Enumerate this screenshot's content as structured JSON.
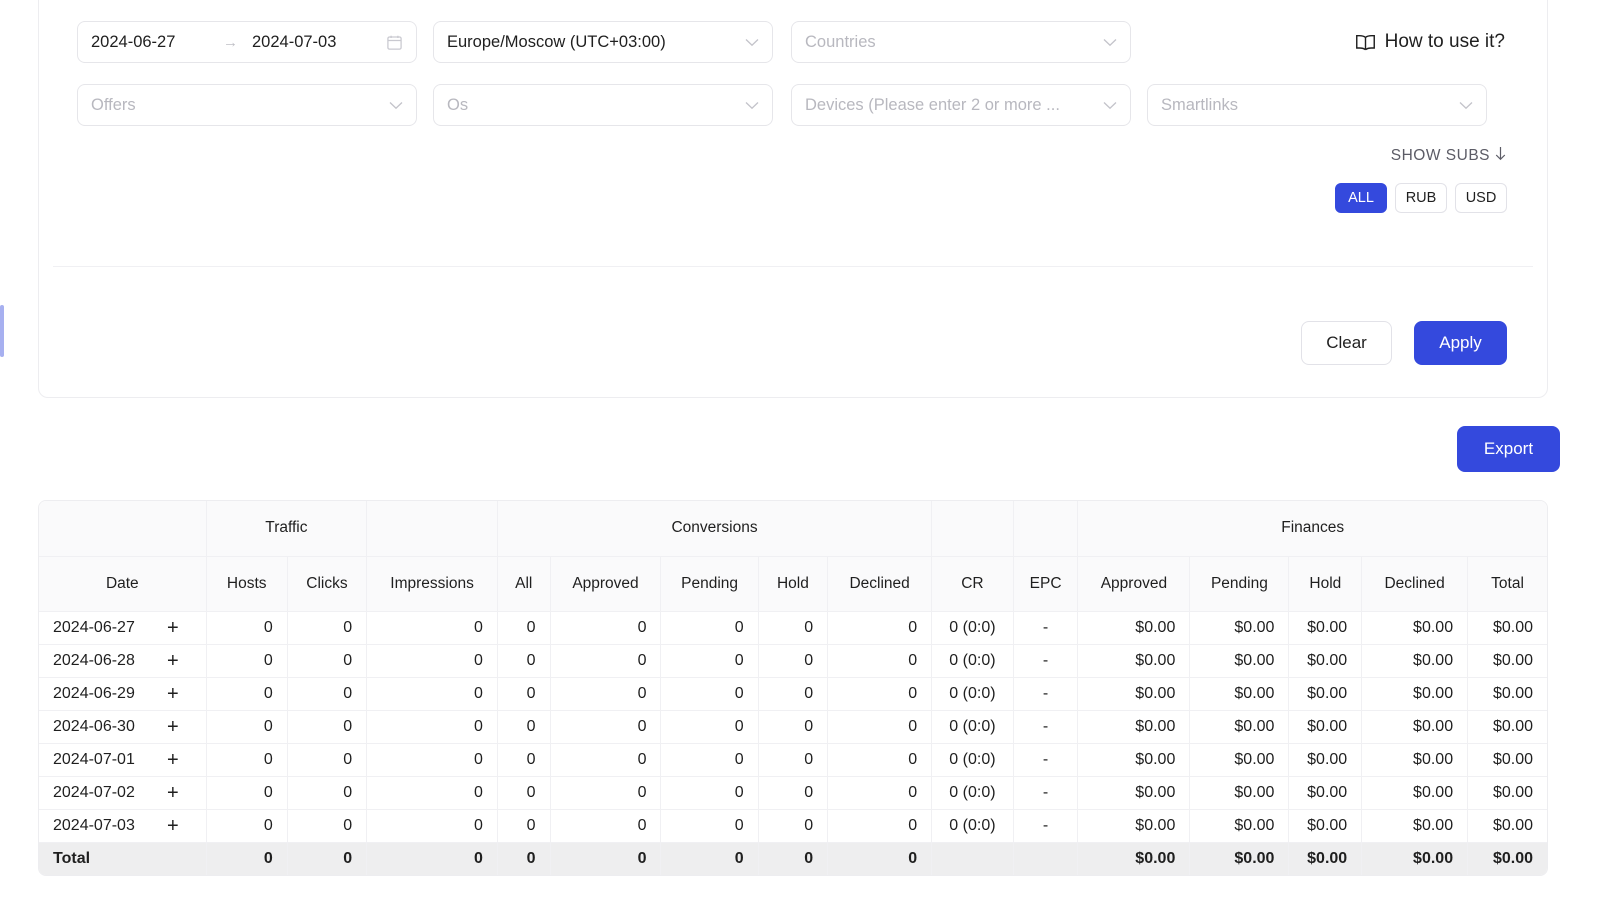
{
  "filters": {
    "date_range": {
      "start": "2024-06-27",
      "end": "2024-07-03",
      "arrow": "→",
      "icon": "calendar-icon"
    },
    "timezone": {
      "value": "Europe/Moscow (UTC+03:00)"
    },
    "countries": {
      "placeholder": "Countries"
    },
    "offers": {
      "placeholder": "Offers"
    },
    "os": {
      "placeholder": "Os"
    },
    "devices": {
      "placeholder": "Devices (Please enter 2 or more ..."
    },
    "smartlinks": {
      "placeholder": "Smartlinks"
    },
    "how_to_use": {
      "label": "How to use it?",
      "icon": "book-icon"
    },
    "show_subs": {
      "label": "SHOW SUBS",
      "icon": "arrow-down-icon"
    },
    "currency": {
      "options": [
        "ALL",
        "RUB",
        "USD"
      ],
      "selected": "ALL"
    },
    "actions": {
      "clear": "Clear",
      "apply": "Apply"
    }
  },
  "export": {
    "label": "Export"
  },
  "colors": {
    "accent": "#3449dd",
    "border": "#ededf0",
    "header_bg": "#fafafb",
    "total_bg": "#eeeeef",
    "placeholder": "#b8b8bf"
  },
  "table": {
    "groups": [
      {
        "label": "",
        "span": 1
      },
      {
        "label": "Traffic",
        "span": 2
      },
      {
        "label": "",
        "span": 1
      },
      {
        "label": "Conversions",
        "span": 5
      },
      {
        "label": "",
        "span": 1
      },
      {
        "label": "",
        "span": 1
      },
      {
        "label": "Finances",
        "span": 5
      }
    ],
    "columns": [
      "Date",
      "Hosts",
      "Clicks",
      "Impressions",
      "All",
      "Approved",
      "Pending",
      "Hold",
      "Declined",
      "CR",
      "EPC",
      "Approved",
      "Pending",
      "Hold",
      "Declined",
      "Total"
    ],
    "rows": [
      {
        "date": "2024-06-27",
        "expand": "+",
        "hosts": "0",
        "clicks": "0",
        "impressions": "0",
        "conv_all": "0",
        "conv_approved": "0",
        "conv_pending": "0",
        "conv_hold": "0",
        "conv_declined": "0",
        "cr": "0 (0:0)",
        "epc": "-",
        "fin_approved": "$0.00",
        "fin_pending": "$0.00",
        "fin_hold": "$0.00",
        "fin_declined": "$0.00",
        "fin_total": "$0.00"
      },
      {
        "date": "2024-06-28",
        "expand": "+",
        "hosts": "0",
        "clicks": "0",
        "impressions": "0",
        "conv_all": "0",
        "conv_approved": "0",
        "conv_pending": "0",
        "conv_hold": "0",
        "conv_declined": "0",
        "cr": "0 (0:0)",
        "epc": "-",
        "fin_approved": "$0.00",
        "fin_pending": "$0.00",
        "fin_hold": "$0.00",
        "fin_declined": "$0.00",
        "fin_total": "$0.00"
      },
      {
        "date": "2024-06-29",
        "expand": "+",
        "hosts": "0",
        "clicks": "0",
        "impressions": "0",
        "conv_all": "0",
        "conv_approved": "0",
        "conv_pending": "0",
        "conv_hold": "0",
        "conv_declined": "0",
        "cr": "0 (0:0)",
        "epc": "-",
        "fin_approved": "$0.00",
        "fin_pending": "$0.00",
        "fin_hold": "$0.00",
        "fin_declined": "$0.00",
        "fin_total": "$0.00"
      },
      {
        "date": "2024-06-30",
        "expand": "+",
        "hosts": "0",
        "clicks": "0",
        "impressions": "0",
        "conv_all": "0",
        "conv_approved": "0",
        "conv_pending": "0",
        "conv_hold": "0",
        "conv_declined": "0",
        "cr": "0 (0:0)",
        "epc": "-",
        "fin_approved": "$0.00",
        "fin_pending": "$0.00",
        "fin_hold": "$0.00",
        "fin_declined": "$0.00",
        "fin_total": "$0.00"
      },
      {
        "date": "2024-07-01",
        "expand": "+",
        "hosts": "0",
        "clicks": "0",
        "impressions": "0",
        "conv_all": "0",
        "conv_approved": "0",
        "conv_pending": "0",
        "conv_hold": "0",
        "conv_declined": "0",
        "cr": "0 (0:0)",
        "epc": "-",
        "fin_approved": "$0.00",
        "fin_pending": "$0.00",
        "fin_hold": "$0.00",
        "fin_declined": "$0.00",
        "fin_total": "$0.00"
      },
      {
        "date": "2024-07-02",
        "expand": "+",
        "hosts": "0",
        "clicks": "0",
        "impressions": "0",
        "conv_all": "0",
        "conv_approved": "0",
        "conv_pending": "0",
        "conv_hold": "0",
        "conv_declined": "0",
        "cr": "0 (0:0)",
        "epc": "-",
        "fin_approved": "$0.00",
        "fin_pending": "$0.00",
        "fin_hold": "$0.00",
        "fin_declined": "$0.00",
        "fin_total": "$0.00"
      },
      {
        "date": "2024-07-03",
        "expand": "+",
        "hosts": "0",
        "clicks": "0",
        "impressions": "0",
        "conv_all": "0",
        "conv_approved": "0",
        "conv_pending": "0",
        "conv_hold": "0",
        "conv_declined": "0",
        "cr": "0 (0:0)",
        "epc": "-",
        "fin_approved": "$0.00",
        "fin_pending": "$0.00",
        "fin_hold": "$0.00",
        "fin_declined": "$0.00",
        "fin_total": "$0.00"
      }
    ],
    "total": {
      "date": "Total",
      "hosts": "0",
      "clicks": "0",
      "impressions": "0",
      "conv_all": "0",
      "conv_approved": "0",
      "conv_pending": "0",
      "conv_hold": "0",
      "conv_declined": "0",
      "cr": "",
      "epc": "",
      "fin_approved": "$0.00",
      "fin_pending": "$0.00",
      "fin_hold": "$0.00",
      "fin_declined": "$0.00",
      "fin_total": "$0.00"
    }
  }
}
